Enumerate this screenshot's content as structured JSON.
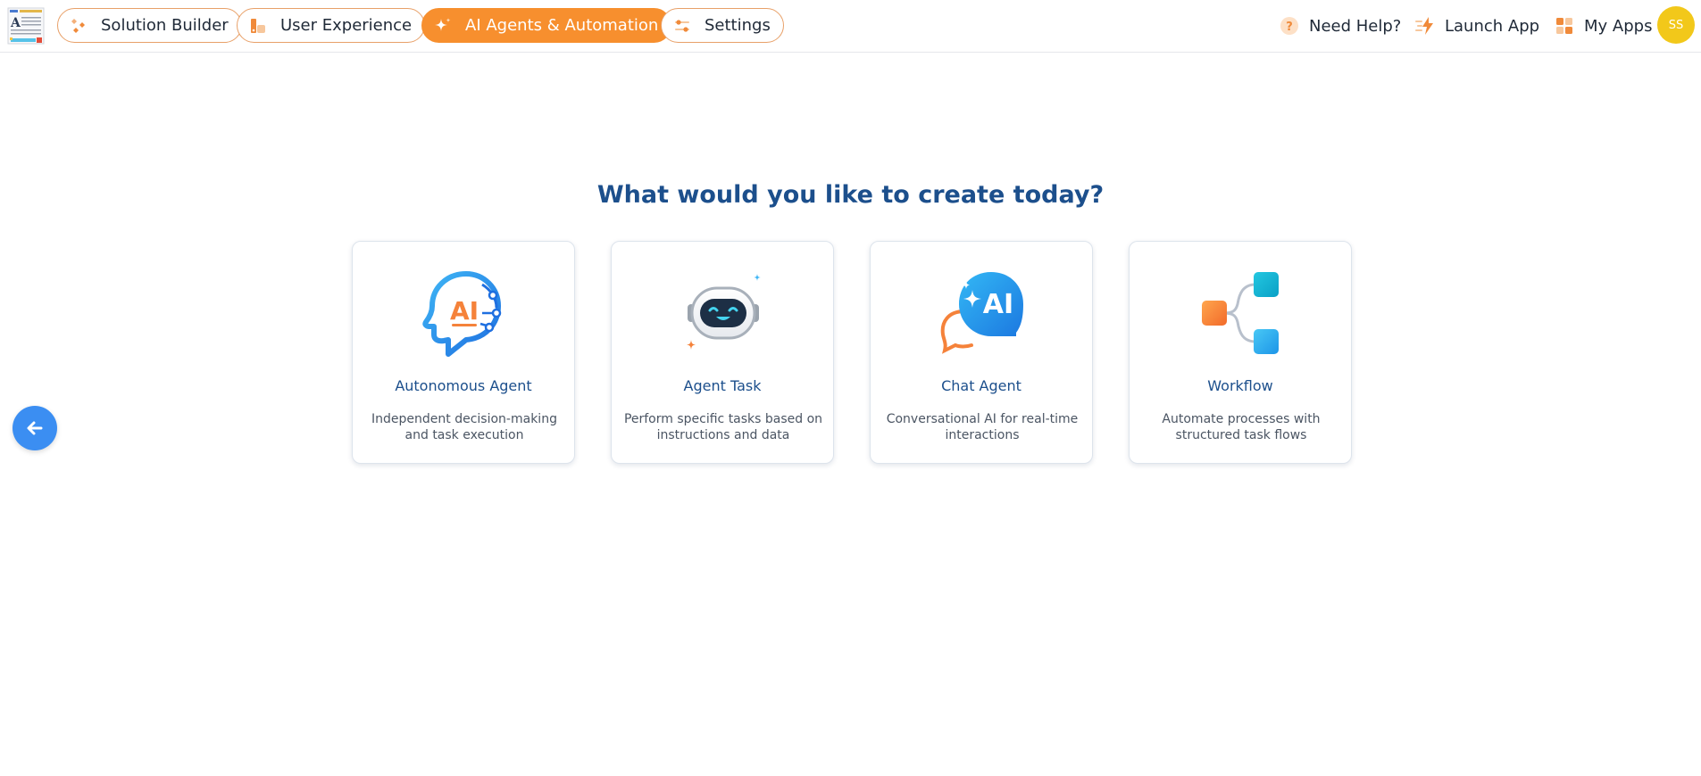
{
  "nav": {
    "tabs": [
      {
        "label": "Solution Builder",
        "active": false
      },
      {
        "label": "User Experience",
        "active": false
      },
      {
        "label": "AI Agents & Automation",
        "active": true
      },
      {
        "label": "Settings",
        "active": false
      }
    ],
    "right": {
      "help_label": "Need Help?",
      "launch_label": "Launch App",
      "apps_label": "My Apps",
      "avatar_initials": "SS"
    }
  },
  "main": {
    "title": "What would you like to create today?",
    "cards": [
      {
        "title": "Autonomous Agent",
        "description": "Independent decision-making and task execution",
        "icon": "ai-head-icon"
      },
      {
        "title": "Agent Task",
        "description": "Perform specific tasks based on instructions and data",
        "icon": "robot-icon"
      },
      {
        "title": "Chat Agent",
        "description": "Conversational AI for real-time interactions",
        "icon": "ai-chat-icon"
      },
      {
        "title": "Workflow",
        "description": "Automate processes with structured task flows",
        "icon": "workflow-icon"
      }
    ]
  },
  "colors": {
    "accent": "#f78f2e",
    "title": "#1c4f8c",
    "back_button": "#3b8ef2",
    "avatar": "#f2c81a"
  }
}
